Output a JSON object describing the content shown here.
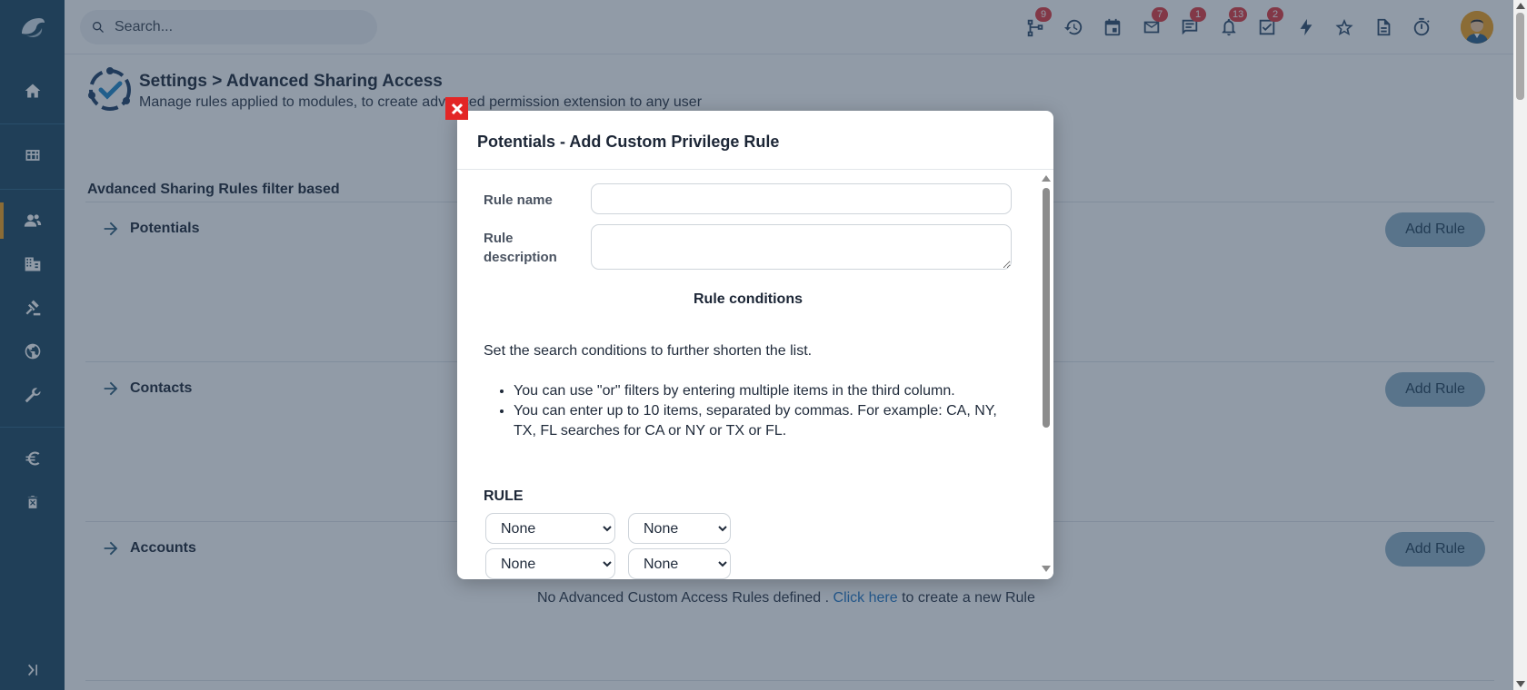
{
  "topbar": {
    "search_placeholder": "Search...",
    "badges": {
      "workflow": "9",
      "mail": "7",
      "chat": "1",
      "notifications": "13",
      "tasks": "2"
    }
  },
  "page": {
    "title": "Settings > Advanced Sharing Access",
    "subtitle": "Manage rules applied to modules, to create advanced permission extension to any user",
    "section_heading": "Avdanced Sharing Rules filter based",
    "modules": [
      {
        "name": "Potentials",
        "button": "Add Rule"
      },
      {
        "name": "Contacts",
        "button": "Add Rule"
      },
      {
        "name": "Accounts",
        "button": "Add Rule"
      }
    ],
    "empty_message": "No Advanced Custom Access Rules defined .",
    "empty_link": "Click here",
    "empty_suffix": "to create a new Rule"
  },
  "modal": {
    "title": "Potentials - Add Custom Privilege Rule",
    "rule_name_label": "Rule name",
    "rule_name_value": "",
    "rule_description_label_1": "Rule",
    "rule_description_label_2": "description",
    "rule_description_value": "",
    "conditions_title": "Rule conditions",
    "conditions_intro": "Set the search conditions to further shorten the list.",
    "tips": [
      "You can use \"or\" filters by entering multiple items in the third column.",
      "You can enter up to 10 items, separated by commas. For example: CA, NY, TX, FL searches for CA or NY or TX or FL."
    ],
    "rule_heading": "RULE",
    "selects": [
      "None",
      "None",
      "None",
      "None"
    ]
  },
  "colors": {
    "sidebar": "#1c4760",
    "accent": "#f2a01c",
    "badge": "#e0393e",
    "close": "#e32626",
    "link": "#2377c5"
  }
}
